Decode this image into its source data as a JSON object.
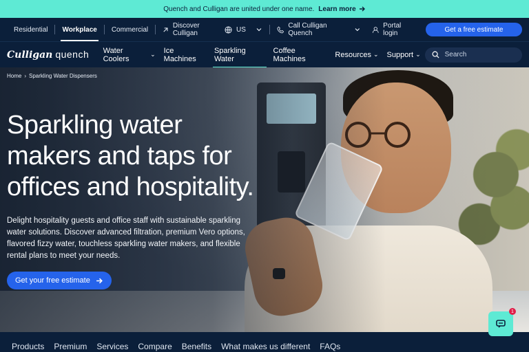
{
  "announcement": {
    "text": "Quench and Culligan are united under one name.",
    "link": "Learn more"
  },
  "utility_nav": {
    "segments": [
      "Residential",
      "Workplace",
      "Commercial"
    ],
    "discover": "Discover Culligan",
    "region": "US",
    "call": "Call Culligan Quench",
    "portal": "Portal login",
    "cta": "Get a free estimate"
  },
  "brand": {
    "part1": "Culligan",
    "part2": "quench"
  },
  "main_nav": {
    "items": [
      {
        "label": "Water Coolers",
        "dropdown": true
      },
      {
        "label": "Ice Machines",
        "dropdown": false
      },
      {
        "label": "Sparkling Water",
        "dropdown": false
      },
      {
        "label": "Coffee Machines",
        "dropdown": false
      },
      {
        "label": "Resources",
        "dropdown": true
      },
      {
        "label": "Support",
        "dropdown": true
      }
    ],
    "search_placeholder": "Search"
  },
  "breadcrumb": {
    "home": "Home",
    "current": "Sparkling Water Dispensers"
  },
  "hero": {
    "title_l1": "Sparkling water",
    "title_l2": "makers and taps for",
    "title_l3": "offices and hospitality.",
    "description": "Delight hospitality guests and office staff with sustainable sparkling water solutions. Discover advanced filtration, premium Vero options, flavored fizzy water, touchless sparkling water makers, and flexible rental plans to meet your needs.",
    "cta": "Get your free estimate"
  },
  "chat": {
    "badge": "1"
  },
  "bottom_tabs": [
    "Products",
    "Premium",
    "Services",
    "Compare",
    "Benefits",
    "What makes us different",
    "FAQs"
  ],
  "colors": {
    "navy": "#0b1f3a",
    "mint": "#5eead4",
    "blue": "#2563eb"
  }
}
